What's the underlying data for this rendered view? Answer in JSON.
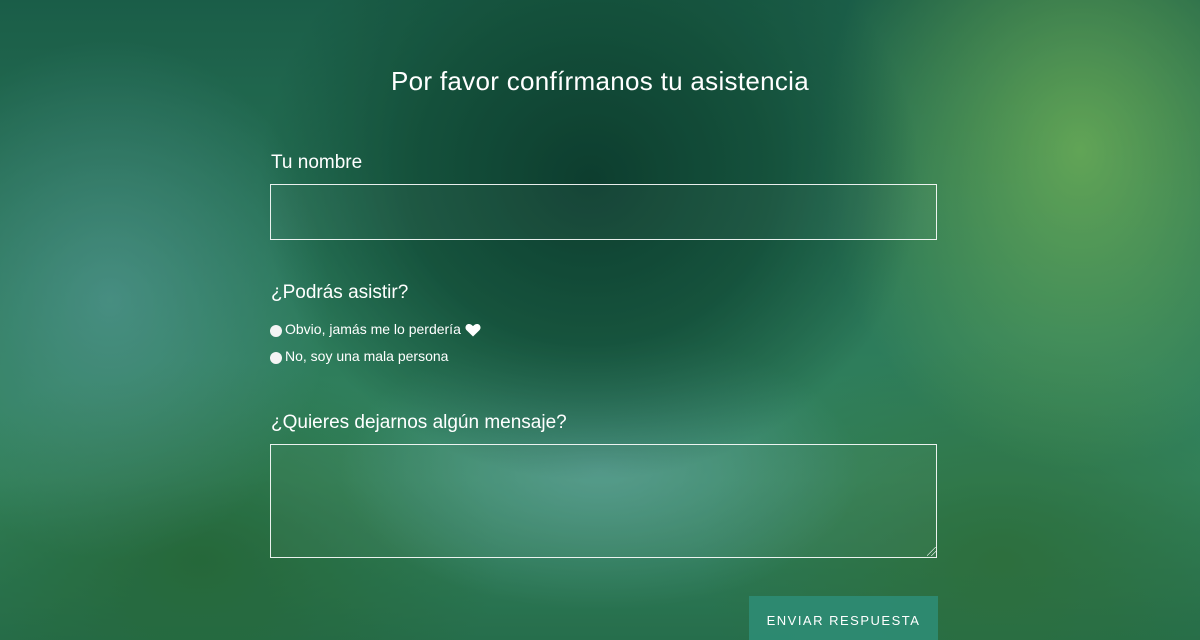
{
  "form": {
    "title": "Por favor confírmanos tu asistencia",
    "name_label": "Tu nombre",
    "name_value": "",
    "attend_label": "¿Podrás asistir?",
    "options": [
      {
        "label": "Obvio, jamás me lo perdería",
        "icon": "heart-icon"
      },
      {
        "label": "No, soy una mala persona"
      }
    ],
    "message_label": "¿Quieres dejarnos algún mensaje?",
    "message_value": "",
    "submit_label": "ENVIAR RESPUESTA"
  },
  "colors": {
    "overlay_tint": "#146e50",
    "button_bg": "#2e8c74",
    "text": "#ffffff"
  }
}
